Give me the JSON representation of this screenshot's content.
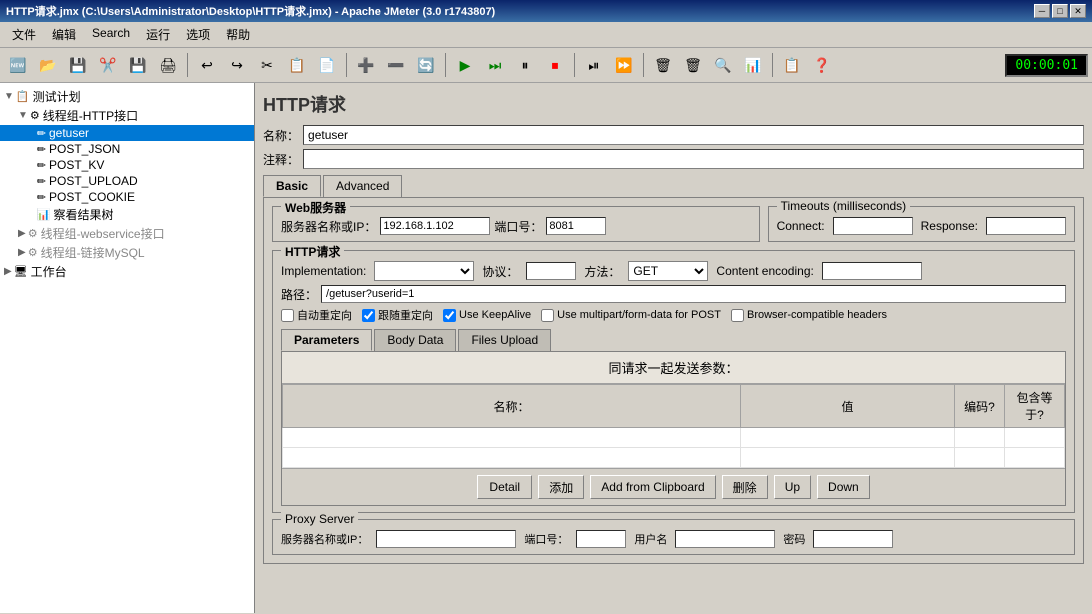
{
  "window": {
    "title": "HTTP请求.jmx (C:\\Users\\Administrator\\Desktop\\HTTP请求.jmx) - Apache JMeter (3.0 r1743807)"
  },
  "title_controls": {
    "minimize": "─",
    "maximize": "□",
    "close": "✕"
  },
  "menu": {
    "items": [
      "文件",
      "编辑",
      "Search",
      "运行",
      "选项",
      "帮助"
    ]
  },
  "toolbar": {
    "time": "00:00:01"
  },
  "tree": {
    "items": [
      {
        "label": "测试计划",
        "level": 0,
        "icon": "📋",
        "expand": "▼"
      },
      {
        "label": "线程组-HTTP接口",
        "level": 1,
        "icon": "⚙",
        "expand": "▼"
      },
      {
        "label": "getuser",
        "level": 2,
        "icon": "✏",
        "expand": "",
        "selected": true
      },
      {
        "label": "POST_JSON",
        "level": 2,
        "icon": "✏",
        "expand": ""
      },
      {
        "label": "POST_KV",
        "level": 2,
        "icon": "✏",
        "expand": ""
      },
      {
        "label": "POST_UPLOAD",
        "level": 2,
        "icon": "✏",
        "expand": ""
      },
      {
        "label": "POST_COOKIE",
        "level": 2,
        "icon": "✏",
        "expand": ""
      },
      {
        "label": "察看结果树",
        "level": 2,
        "icon": "📊",
        "expand": ""
      },
      {
        "label": "线程组-webservice接口",
        "level": 1,
        "icon": "⚙",
        "expand": "▶"
      },
      {
        "label": "线程组-链接MySQL",
        "level": 1,
        "icon": "⚙",
        "expand": "▶"
      },
      {
        "label": "工作台",
        "level": 0,
        "icon": "🖥",
        "expand": "▶"
      }
    ]
  },
  "http_request": {
    "title": "HTTP请求",
    "name_label": "名称：",
    "name_value": "getuser",
    "comment_label": "注释：",
    "comment_value": ""
  },
  "tabs": {
    "basic_label": "Basic",
    "advanced_label": "Advanced"
  },
  "web_server": {
    "section_title": "Web服务器",
    "server_label": "服务器名称或IP：",
    "server_value": "192.168.1.102",
    "port_label": "端口号：",
    "port_value": "8081",
    "timeouts_title": "Timeouts (milliseconds)",
    "connect_label": "Connect:",
    "connect_value": "",
    "response_label": "Response:",
    "response_value": ""
  },
  "http_request_section": {
    "title": "HTTP请求",
    "implementation_label": "Implementation:",
    "implementation_value": "",
    "protocol_label": "协议：",
    "protocol_value": "",
    "method_label": "方法：",
    "method_value": "GET",
    "encoding_label": "Content encoding:",
    "encoding_value": "",
    "path_label": "路径：",
    "path_value": "/getuser?userid=1",
    "checkboxes": [
      {
        "label": "自动重定向",
        "checked": false
      },
      {
        "label": "跟随重定向",
        "checked": true
      },
      {
        "label": "Use KeepAlive",
        "checked": true
      },
      {
        "label": "Use multipart/form-data for POST",
        "checked": false
      },
      {
        "label": "Browser-compatible headers",
        "checked": false
      }
    ]
  },
  "inner_tabs": {
    "parameters_label": "Parameters",
    "body_data_label": "Body Data",
    "files_upload_label": "Files Upload"
  },
  "params_table": {
    "header": "同请求一起发送参数：",
    "columns": [
      "名称：",
      "值",
      "编码?",
      "包含等于?"
    ],
    "rows": []
  },
  "action_buttons": [
    {
      "label": "Detail",
      "key": "detail"
    },
    {
      "label": "添加",
      "key": "add"
    },
    {
      "label": "Add from Clipboard",
      "key": "add_clipboard"
    },
    {
      "label": "删除",
      "key": "delete"
    },
    {
      "label": "Up",
      "key": "up"
    },
    {
      "label": "Down",
      "key": "down"
    }
  ],
  "proxy_server": {
    "title": "Proxy Server",
    "server_label": "服务器名称或IP：",
    "server_value": "",
    "port_label": "端口号：",
    "port_value": "",
    "username_label": "用户名",
    "username_value": "",
    "password_label": "密码",
    "password_value": ""
  }
}
